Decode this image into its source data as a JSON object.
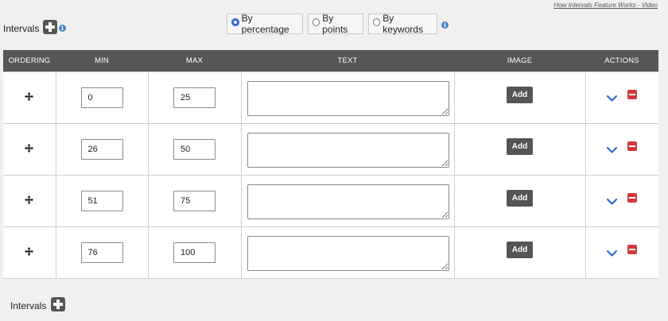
{
  "header": {
    "help_link": "How Intervals Feature Works - Video",
    "intervals_label": "Intervals",
    "info_glyph": "i"
  },
  "mode": {
    "options": [
      {
        "label": "By percentage",
        "checked": true
      },
      {
        "label": "By points",
        "checked": false
      },
      {
        "label": "By keywords",
        "checked": false
      }
    ]
  },
  "table": {
    "columns": [
      "ORDERING",
      "MIN",
      "MAX",
      "TEXT",
      "IMAGE",
      "ACTIONS"
    ],
    "rows": [
      {
        "min": "0",
        "max": "25",
        "text": "",
        "image_button": "Add"
      },
      {
        "min": "26",
        "max": "50",
        "text": "",
        "image_button": "Add"
      },
      {
        "min": "51",
        "max": "75",
        "text": "",
        "image_button": "Add"
      },
      {
        "min": "76",
        "max": "100",
        "text": "",
        "image_button": "Add"
      }
    ]
  },
  "footer": {
    "intervals_label": "Intervals"
  },
  "colors": {
    "header_bg": "#565656",
    "accent_blue": "#2d6ad6",
    "remove_red": "#d23a3a",
    "button_dark": "#555555"
  },
  "icons": {
    "add": "plus-icon",
    "info": "info-icon",
    "ordering": "move-icon",
    "expand": "chevron-down-icon",
    "remove": "minus-icon"
  }
}
